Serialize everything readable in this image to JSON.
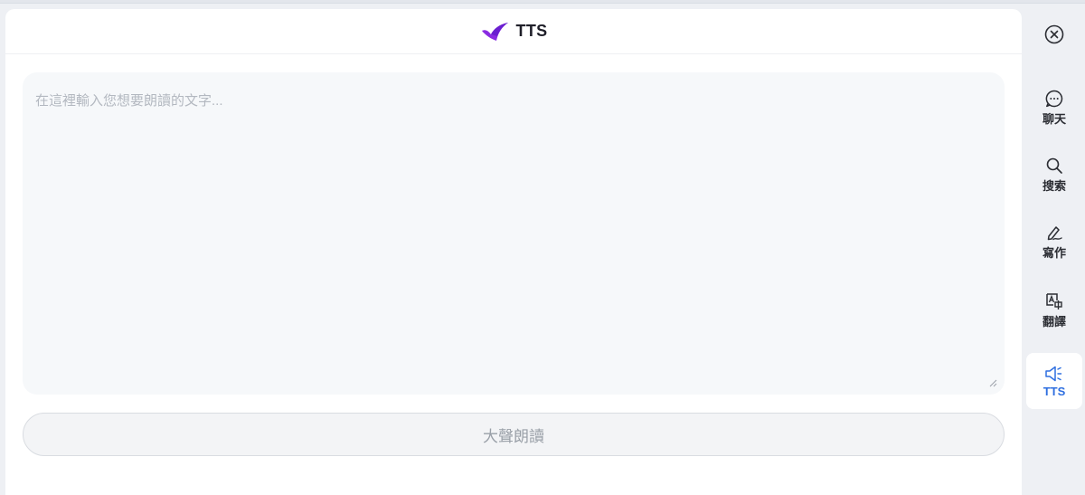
{
  "app": {
    "title": "TTS",
    "brand_color": "#7b2ff2"
  },
  "editor": {
    "placeholder": "在這裡輸入您想要朗讀的文字..."
  },
  "actions": {
    "speak_label": "大聲朗讀"
  },
  "sidebar": {
    "close_icon": "close-circle-icon",
    "items": [
      {
        "label": "聊天",
        "icon": "chat-bubble-icon",
        "active": false
      },
      {
        "label": "搜索",
        "icon": "search-icon",
        "active": false
      },
      {
        "label": "寫作",
        "icon": "pen-icon",
        "active": false
      },
      {
        "label": "翻譯",
        "icon": "translate-icon",
        "active": false
      },
      {
        "label": "TTS",
        "icon": "speaker-icon",
        "active": true
      }
    ]
  }
}
